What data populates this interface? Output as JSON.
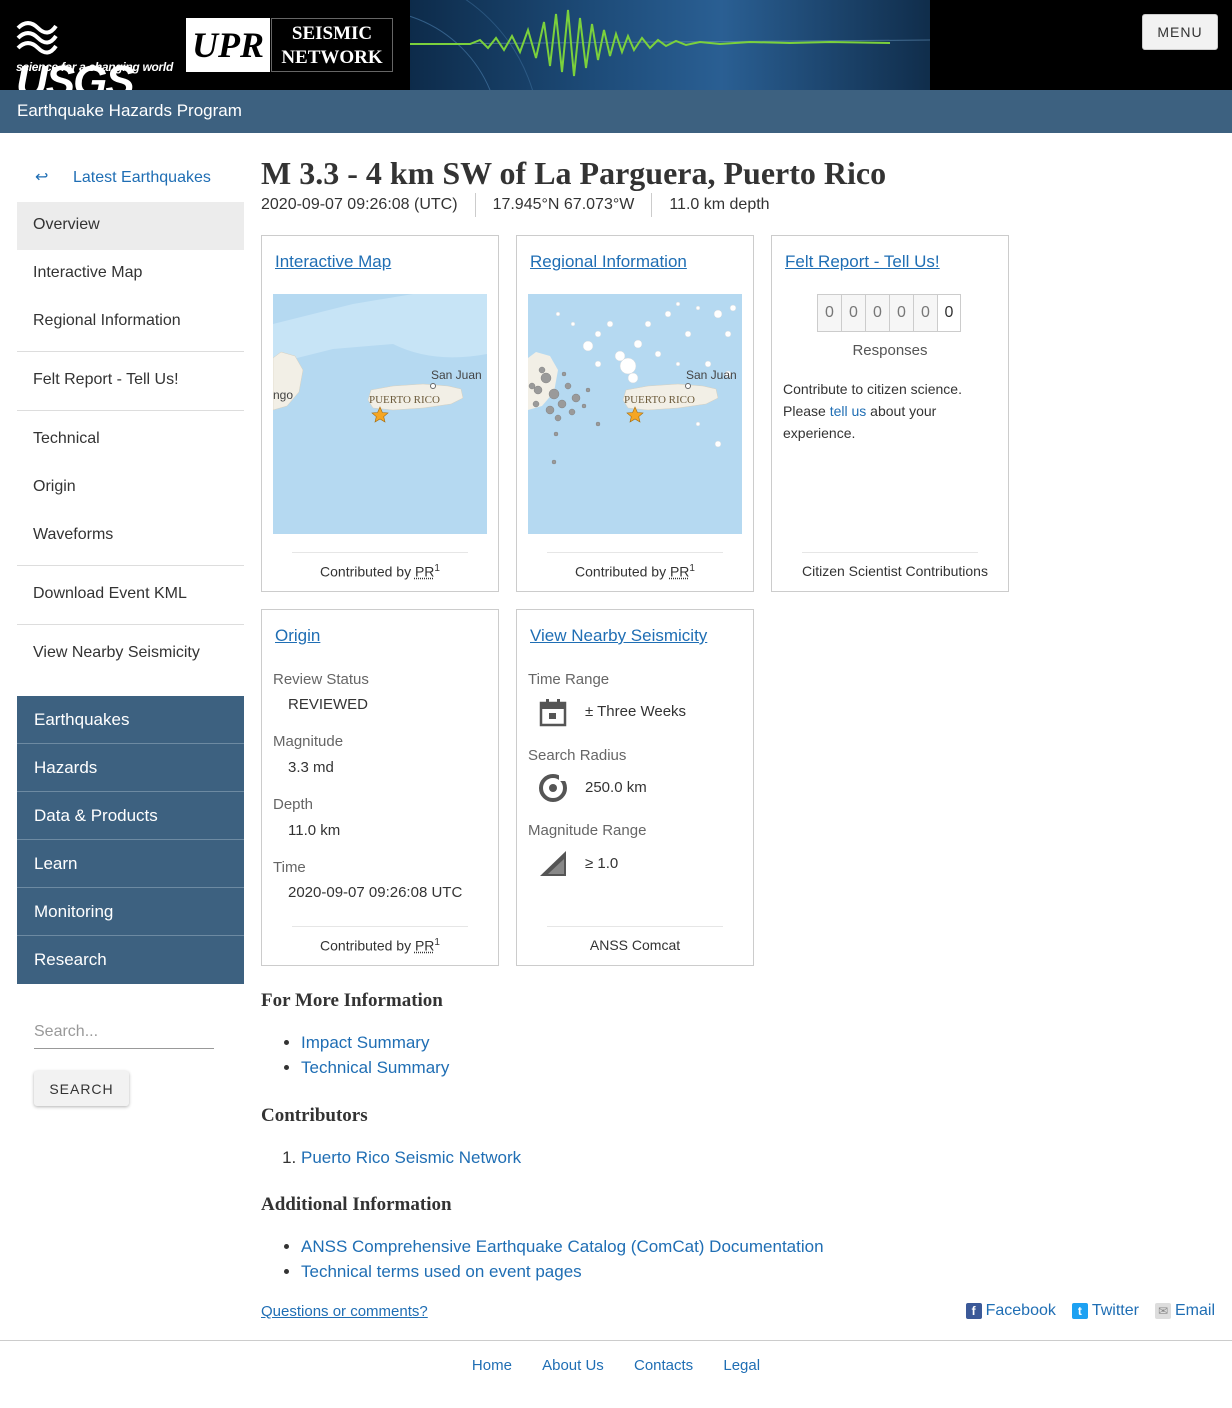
{
  "header": {
    "usgs_word": "USGS",
    "usgs_tagline": "science for a changing world",
    "upr_logo": "UPR",
    "seismic_line1": "SEISMIC",
    "seismic_line2": "NETWORK",
    "menu_label": "MENU",
    "program_name": "Earthquake Hazards Program"
  },
  "sidebar": {
    "back_arrow": "↩",
    "back_label": "Latest Earthquakes",
    "items": [
      "Overview",
      "Interactive Map",
      "Regional Information",
      "Felt Report - Tell Us!",
      "Technical",
      "Origin",
      "Waveforms",
      "Download Event KML",
      "View Nearby Seismicity"
    ],
    "active_index": 0
  },
  "site_nav": [
    "Earthquakes",
    "Hazards",
    "Data & Products",
    "Learn",
    "Monitoring",
    "Research"
  ],
  "search": {
    "placeholder": "Search...",
    "button_label": "SEARCH"
  },
  "event": {
    "title": "M 3.3 - 4 km SW of La Parguera, Puerto Rico",
    "time": "2020-09-07 09:26:08 (UTC)",
    "location": "17.945°N 67.073°W",
    "depth": "11.0 km depth"
  },
  "cards": {
    "interactive_map": {
      "title": "Interactive Map",
      "map_label_city": "San Juan",
      "map_label_island": "PUERTO RICO",
      "map_label_west": "ngo",
      "contributed_prefix": "Contributed by",
      "contributor": "PR",
      "contributor_ref": "1"
    },
    "regional": {
      "title": "Regional Information",
      "map_label_city": "San Juan",
      "map_label_island": "PUERTO RICO",
      "contributed_prefix": "Contributed by",
      "contributor": "PR",
      "contributor_ref": "1"
    },
    "felt": {
      "title": "Felt Report - Tell Us!",
      "digits": [
        "0",
        "0",
        "0",
        "0",
        "0",
        "0"
      ],
      "responses_label": "Responses",
      "text_before": "Contribute to citizen science. Please ",
      "link_text": "tell us",
      "text_after": " about your experience.",
      "footer": "Citizen Scientist Contributions"
    },
    "origin": {
      "title": "Origin",
      "review_status_label": "Review Status",
      "review_status": "REVIEWED",
      "magnitude_label": "Magnitude",
      "magnitude": "3.3 md",
      "depth_label": "Depth",
      "depth": "11.0 km",
      "time_label": "Time",
      "time": "2020-09-07 09:26:08 UTC",
      "contributed_prefix": "Contributed by",
      "contributor": "PR",
      "contributor_ref": "1"
    },
    "nearby": {
      "title": "View Nearby Seismicity",
      "time_range_label": "Time Range",
      "time_range": "± Three Weeks",
      "radius_label": "Search Radius",
      "radius": "250.0 km",
      "magnitude_range_label": "Magnitude Range",
      "magnitude_range": "≥ 1.0",
      "footer": "ANSS Comcat"
    }
  },
  "more_info": {
    "heading": "For More Information",
    "links": [
      "Impact Summary",
      "Technical Summary"
    ]
  },
  "contributors": {
    "heading": "Contributors",
    "items": [
      "Puerto Rico Seismic Network"
    ]
  },
  "additional": {
    "heading": "Additional Information",
    "links": [
      "ANSS Comprehensive Earthquake Catalog (ComCat) Documentation",
      "Technical terms used on event pages"
    ]
  },
  "footer": {
    "questions": "Questions or comments?",
    "social": {
      "facebook": "Facebook",
      "twitter": "Twitter",
      "email": "Email"
    },
    "links": [
      "Home",
      "About Us",
      "Contacts",
      "Legal"
    ]
  },
  "colors": {
    "link": "#1f6eb4",
    "nav_blue": "#3d6180",
    "map_water": "#b5d9f1",
    "land": "#f2efe6",
    "star": "#f5a623"
  }
}
